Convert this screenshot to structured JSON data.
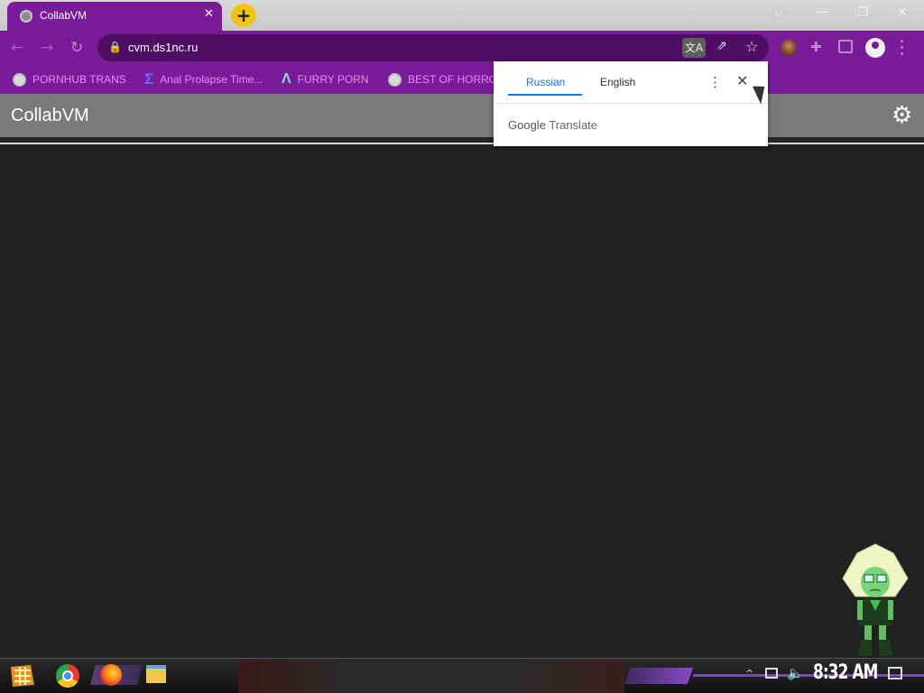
{
  "browser": {
    "tab": {
      "title": "CollabVM",
      "close": "✕"
    },
    "new_tab": "+",
    "window_controls": {
      "dropdown": "⌵",
      "minimize": "—",
      "restore": "❐",
      "close": "✕"
    },
    "address": {
      "url": "cvm.ds1nc.ru"
    },
    "bookmarks": [
      {
        "label": "PORNHUB TRANS",
        "icon": "globe-icon"
      },
      {
        "label": "Anal Prolapse Time...",
        "icon": "sigma-icon"
      },
      {
        "label": "FURRY PORN",
        "icon": "lambda-icon"
      },
      {
        "label": "BEST OF HORRO",
        "icon": "globe-icon"
      }
    ]
  },
  "app": {
    "title": "CollabVM"
  },
  "translate_popup": {
    "tabs": [
      "Russian",
      "English"
    ],
    "active_tab": "Russian",
    "brand_google": "Google",
    "brand_translate": "Translate"
  },
  "taskbar": {
    "clock": "8:32 AM"
  },
  "colors": {
    "accent_purple": "#7a1b9a",
    "link_pink": "#e58df4",
    "translate_blue": "#1a73e8"
  }
}
